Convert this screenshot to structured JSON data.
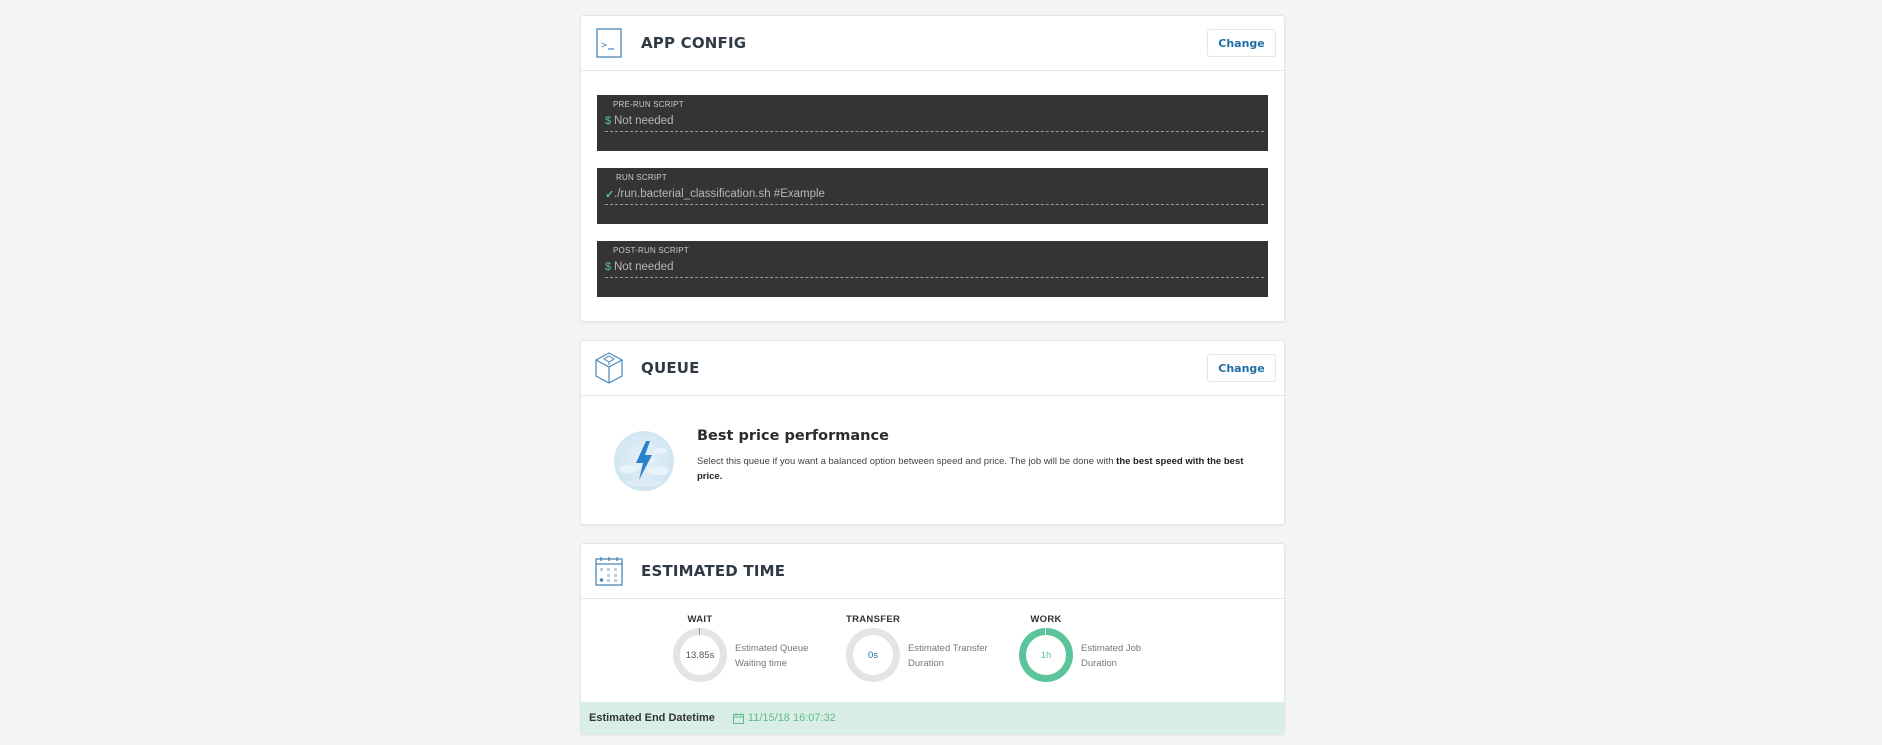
{
  "app_config": {
    "title": "APP CONFIG",
    "change_label": "Change",
    "icon": "terminal-icon",
    "scripts": [
      {
        "label": "PRE-RUN SCRIPT",
        "prompt": "$",
        "value": "Not needed"
      },
      {
        "label": "RUN SCRIPT",
        "prompt": "✓",
        "value": "./run.bacterial_classification.sh #Example"
      },
      {
        "label": "POST-RUN SCRIPT",
        "prompt": "$",
        "value": "Not needed"
      }
    ]
  },
  "queue": {
    "title": "QUEUE",
    "change_label": "Change",
    "icon": "cube-icon",
    "option_title": "Best price performance",
    "option_desc": "Select this queue if you want a balanced option between speed and price. The job will be done with ",
    "option_desc_bold": "the best speed with the best price."
  },
  "estimated_time": {
    "title": "ESTIMATED TIME",
    "icon": "calendar-icon",
    "metrics": [
      {
        "title": "WAIT",
        "value": "13.85s",
        "desc_line1": "Estimated Queue",
        "desc_line2": "Waiting time"
      },
      {
        "title": "TRANSFER",
        "value": "0s",
        "desc_line1": "Estimated Transfer",
        "desc_line2": "Duration"
      },
      {
        "title": "WORK",
        "value": "1h",
        "desc_line1": "Estimated Job",
        "desc_line2": "Duration"
      }
    ],
    "end_label": "Estimated End Datetime",
    "end_value": "11/15/18 16:07:32"
  },
  "colors": {
    "accent": "#1f6fa6",
    "green": "#5cc49a",
    "terminal_bg": "#343434",
    "end_bar_bg": "#d9efe6"
  }
}
